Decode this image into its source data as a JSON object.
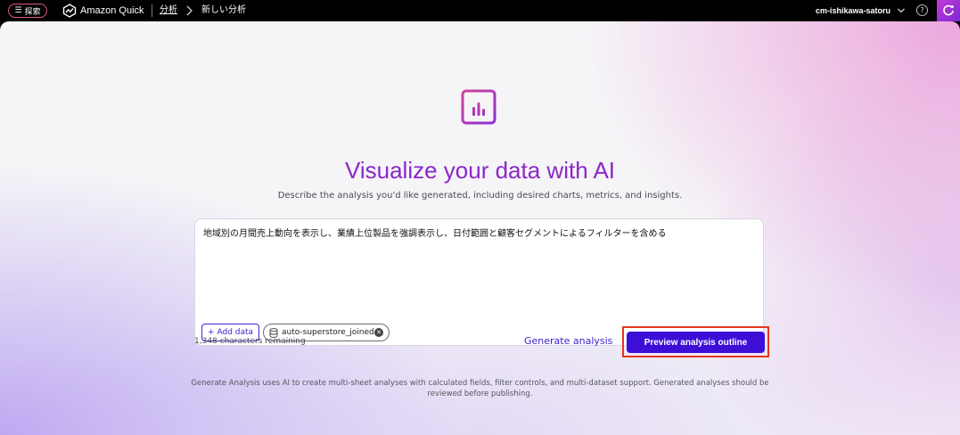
{
  "topbar": {
    "explore_label": "探索",
    "app_title": "Amazon Quick",
    "breadcrumb_link": "分析",
    "breadcrumb_current": "新しい分析",
    "account_name": "cm-ishikawa-satoru",
    "help_glyph": "?"
  },
  "main": {
    "headline": "Visualize your data with AI",
    "subhead": "Describe the analysis you'd like generated, including desired charts, metrics, and insights.",
    "prompt_value": "地域別の月間売上動向を表示し、業績上位製品を強調表示し、日付範囲と顧客セグメントによるフィルターを含める",
    "add_data_label": "Add data",
    "dataset_chip_label": "auto-superstore_joined",
    "characters_remaining": "1,348 characters remaining",
    "generate_label": "Generate analysis",
    "preview_label": "Preview analysis outline",
    "footnote": "Generate Analysis uses AI to create multi-sheet analyses with calculated fields, filter controls, and multi-dataset support. Generated analyses should be reviewed before publishing."
  },
  "colors": {
    "accent": "#3d0fd6",
    "headline": "#8a27c9",
    "highlight": "#e8331e",
    "explore_border": "#e0568a"
  },
  "icons": {
    "explore": "menu-icon",
    "logo": "amazon-quick-logo-icon",
    "chevron": "chevron-right-icon",
    "account_chevron": "chevron-down-icon",
    "help": "help-circle-icon",
    "assistant": "assistant-icon",
    "hero": "chart-window-icon",
    "add": "plus-icon",
    "dataset": "database-icon",
    "remove": "close-circle-icon"
  }
}
